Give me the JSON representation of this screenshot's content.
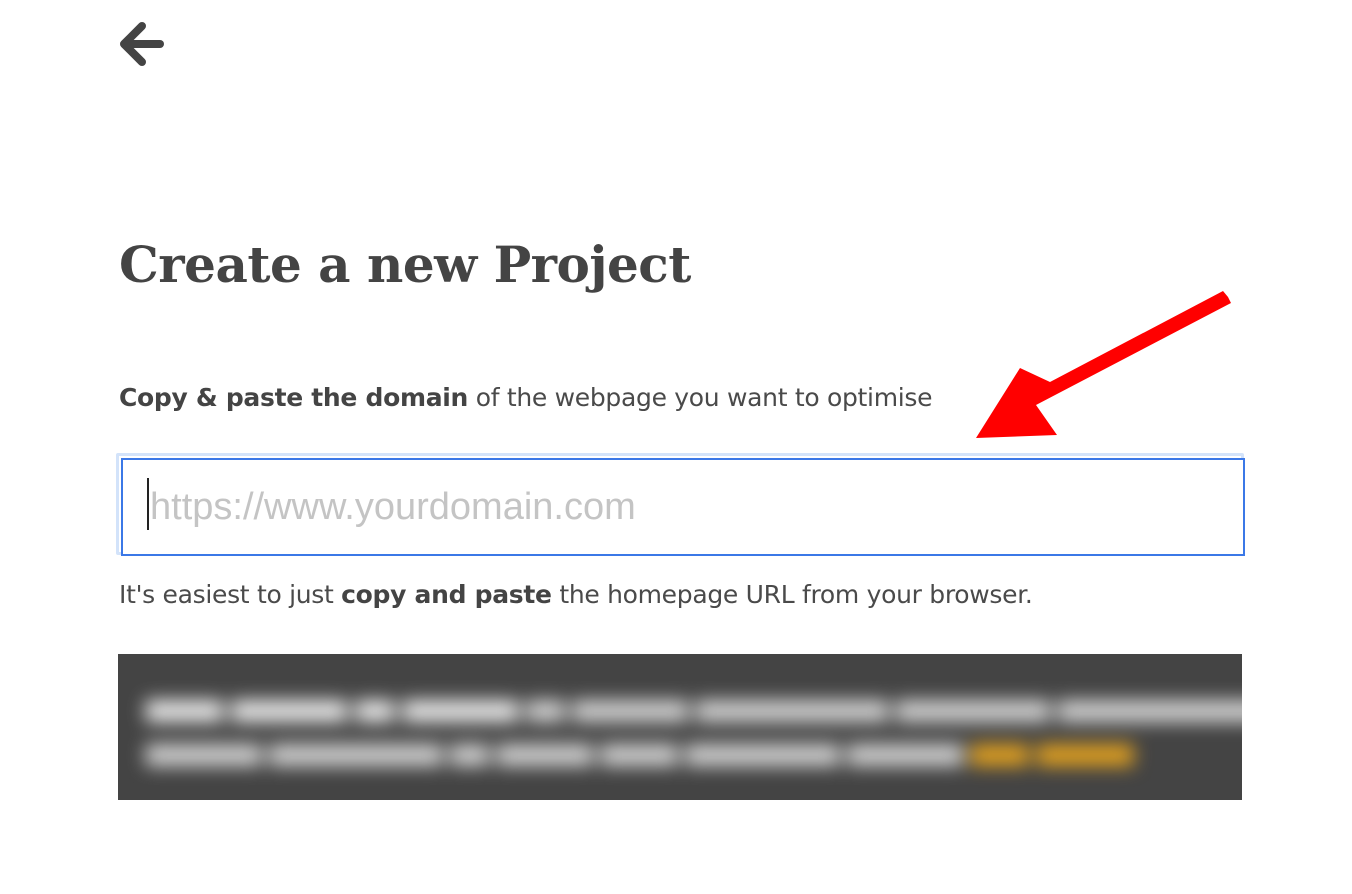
{
  "nav": {
    "back_icon": "arrow-left-icon"
  },
  "page": {
    "title": "Create a new Project"
  },
  "form": {
    "instruction_bold": "Copy & paste the domain",
    "instruction_rest": " of the webpage you want to optimise",
    "url_placeholder": "https://www.yourdomain.com",
    "url_value": "",
    "hint_prefix": "It's easiest to just ",
    "hint_bold": "copy and paste",
    "hint_suffix": " the homepage URL from your browser."
  },
  "colors": {
    "text": "#444444",
    "input_focus_border": "#3b78e7",
    "notice_background": "#444444",
    "annotation_arrow": "#ff0000"
  }
}
